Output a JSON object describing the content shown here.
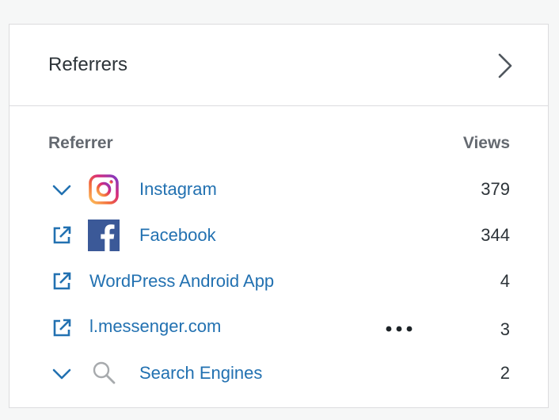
{
  "card": {
    "title": "Referrers"
  },
  "table": {
    "column_referrer": "Referrer",
    "column_views": "Views",
    "rows": [
      {
        "label": "Instagram",
        "views": "379",
        "lead_icon": "chevron-down-icon",
        "brand_icon": "instagram-icon"
      },
      {
        "label": "Facebook",
        "views": "344",
        "lead_icon": "external-link-icon",
        "brand_icon": "facebook-icon"
      },
      {
        "label": "WordPress Android App",
        "views": "4",
        "lead_icon": "external-link-icon"
      },
      {
        "label": "l.messenger.com",
        "views": "3",
        "lead_icon": "external-link-icon",
        "extra_icon": "more-horizontal-icon"
      },
      {
        "label": "Search Engines",
        "views": "2",
        "lead_icon": "chevron-down-icon",
        "brand_icon": "search-icon"
      }
    ]
  },
  "colors": {
    "link": "#2271b1",
    "text": "#2c3338",
    "muted": "#646970",
    "border": "#dcdcde",
    "facebook": "#3b5998"
  }
}
